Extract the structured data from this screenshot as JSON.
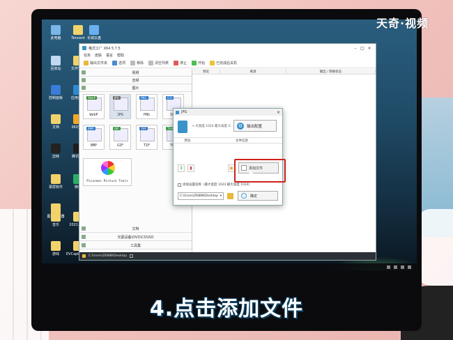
{
  "watermark": "天奇·视频",
  "caption": "4.点击添加文件",
  "desktop_icons": [
    {
      "label": "此电脑",
      "color": "#7ab6e8"
    },
    {
      "label": "Tencent",
      "color": "#f2d26b"
    },
    {
      "label": "长城云盘",
      "color": "#6ab0f0"
    },
    {
      "label": "回收站",
      "color": "#c0d8f0"
    },
    {
      "label": "文件管理",
      "color": "#f2d26b"
    },
    {
      "label": "控制面板",
      "color": "#3a7cd8"
    },
    {
      "label": "应用商店",
      "color": "#2b8bd6"
    },
    {
      "label": "文档",
      "color": "#f2d26b"
    },
    {
      "label": "360安全",
      "color": "#f5a623"
    },
    {
      "label": "剪映",
      "color": "#222222"
    },
    {
      "label": "腾讯QQ",
      "color": "#1e1e1e"
    },
    {
      "label": "录屏软件",
      "color": "#f2d26b"
    },
    {
      "label": "微信",
      "color": "#2aae67"
    },
    {
      "label": "图片编辑器",
      "color": "#f2d26b"
    },
    {
      "label": "2021.7.26",
      "color": "#f2d26b"
    },
    {
      "label": "音乐",
      "color": "#f2d26b"
    },
    {
      "label": "EVCapture录屏",
      "color": "#f2d26b"
    },
    {
      "label": "游戏",
      "color": "#f2d26b"
    }
  ],
  "app": {
    "title": "格式工厂 X64 5.7.5",
    "menu": [
      "任务",
      "皮肤",
      "语言",
      "帮助"
    ],
    "toolbar": [
      "输出文件夹",
      "选项",
      "移除",
      "清空列表",
      "停止",
      "开始",
      "已完成后关机"
    ],
    "categories_top": [
      "视频",
      "音频",
      "图片"
    ],
    "formats": [
      {
        "tag": "WebP",
        "name": "WebP",
        "tag_color": "#3a8a3a",
        "selected": false
      },
      {
        "tag": "JPG",
        "name": "JPG",
        "tag_color": "#6a6a6a",
        "selected": true
      },
      {
        "tag": "PNG",
        "name": "PNG",
        "tag_color": "#2a76c8",
        "selected": false
      },
      {
        "tag": "ICO",
        "name": "ICO",
        "tag_color": "#2a76c8",
        "selected": false
      },
      {
        "tag": "BMP",
        "name": "BMP",
        "tag_color": "#2a76c8",
        "selected": false
      },
      {
        "tag": "GIF",
        "name": "GIF",
        "tag_color": "#3a9a4a",
        "selected": false
      },
      {
        "tag": "TIFF",
        "name": "TIF",
        "tag_color": "#3a7ac0",
        "selected": false
      },
      {
        "tag": "TGA",
        "name": "TGA",
        "tag_color": "#3a9a4a",
        "selected": false
      }
    ],
    "picasa_label": "Picosmos Picture Tools",
    "categories_bottom": [
      "文档",
      "光驱设备\\DVD\\CD\\ISO",
      "工具集"
    ],
    "columns": [
      "预览",
      "来源",
      "输出 / 转换状态"
    ],
    "status_path": "C:\\Users\\ZK888\\Desktop"
  },
  "dialog": {
    "title": "JPG",
    "info": "→ 大宽度 1024  最大高度  G",
    "output_config": "输出配置",
    "columns": [
      "预览",
      "文件信息"
    ],
    "add_file": "添加文件",
    "checkbox_label": "添加设置名称（最大宽度 1024  最大高度 1024）",
    "output_path": "C:\\Users\\ZK888\\Desktop",
    "ok": "确定"
  }
}
